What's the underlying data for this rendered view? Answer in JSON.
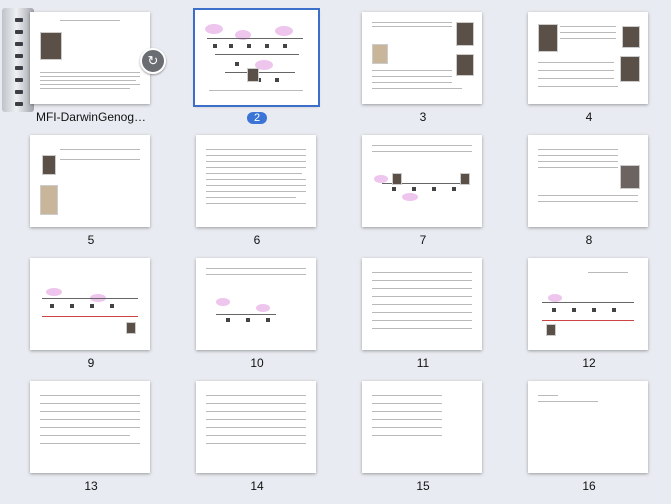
{
  "pages": [
    {
      "label": "MFI-DarwinGenog…"
    },
    {
      "label": "2"
    },
    {
      "label": "3"
    },
    {
      "label": "4"
    },
    {
      "label": "5"
    },
    {
      "label": "6"
    },
    {
      "label": "7"
    },
    {
      "label": "8"
    },
    {
      "label": "9"
    },
    {
      "label": "10"
    },
    {
      "label": "11"
    },
    {
      "label": "12"
    },
    {
      "label": "13"
    },
    {
      "label": "14"
    },
    {
      "label": "15"
    },
    {
      "label": "16"
    }
  ],
  "selected_page": "2",
  "stack_button_icon": "rotate-icon",
  "colors": {
    "selection": "#3a74d6",
    "background": "#e8ebf1"
  }
}
